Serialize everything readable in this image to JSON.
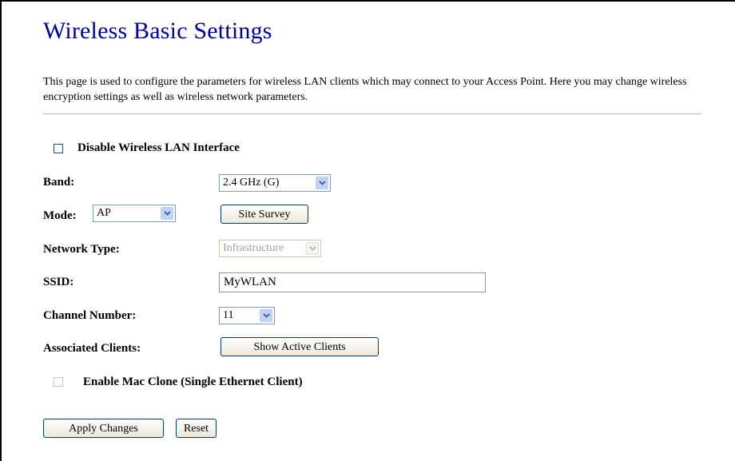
{
  "page": {
    "title": "Wireless Basic Settings",
    "description": "This page is used to configure the parameters for wireless LAN clients which may connect to your Access Point. Here you may change wireless encryption settings as well as wireless network parameters."
  },
  "form": {
    "disable_wlan": {
      "label": "Disable Wireless LAN Interface",
      "checked": false
    },
    "band": {
      "label": "Band:",
      "value": "2.4 GHz (G)"
    },
    "mode": {
      "label": "Mode:",
      "value": "AP",
      "site_survey_label": "Site Survey"
    },
    "network_type": {
      "label": "Network Type:",
      "value": "Infrastructure",
      "disabled": true
    },
    "ssid": {
      "label": "SSID:",
      "value": "MyWLAN"
    },
    "channel": {
      "label": "Channel Number:",
      "value": "11"
    },
    "associated_clients": {
      "label": "Associated Clients:",
      "button_label": "Show Active Clients"
    },
    "mac_clone": {
      "label": "Enable Mac Clone (Single Ethernet Client)",
      "checked": false,
      "disabled": true
    }
  },
  "actions": {
    "apply_label": "Apply Changes",
    "reset_label": "Reset"
  },
  "colors": {
    "title": "#000099",
    "divider": "#b6b6b6",
    "input_border": "#7f9db9",
    "dropdown_arrow_bg": "#c1d3fb",
    "button_border": "#003c74"
  },
  "icons": {
    "dropdown": "chevron-down-icon"
  }
}
